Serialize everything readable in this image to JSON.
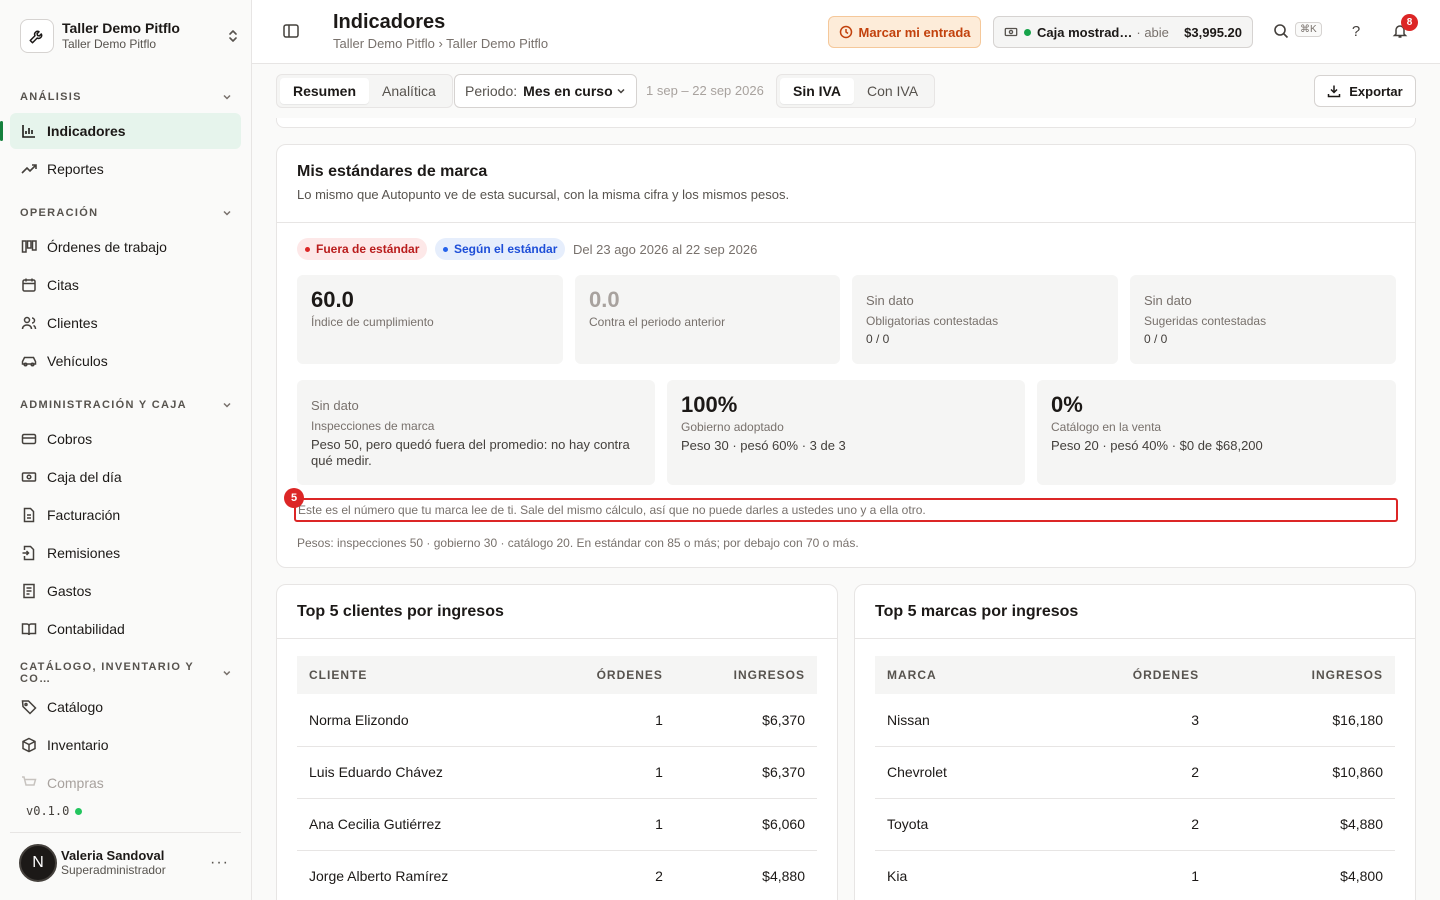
{
  "workspace": {
    "name": "Taller Demo Pitflo",
    "sub": "Taller Demo Pitflo"
  },
  "sidebar": {
    "sections": [
      {
        "label": "ANÁLISIS"
      },
      {
        "label": "OPERACIÓN"
      },
      {
        "label": "ADMINISTRACIÓN Y CAJA"
      },
      {
        "label": "CATÁLOGO, INVENTARIO Y CO…"
      }
    ],
    "items": [
      {
        "label": "Indicadores",
        "icon": "bar-chart-icon"
      },
      {
        "label": "Reportes",
        "icon": "trend-up-icon"
      },
      {
        "label": "Órdenes de trabajo",
        "icon": "kanban-icon"
      },
      {
        "label": "Citas",
        "icon": "calendar-icon"
      },
      {
        "label": "Clientes",
        "icon": "users-icon"
      },
      {
        "label": "Vehículos",
        "icon": "car-icon"
      },
      {
        "label": "Cobros",
        "icon": "card-icon"
      },
      {
        "label": "Caja del día",
        "icon": "cash-icon"
      },
      {
        "label": "Facturación",
        "icon": "file-icon"
      },
      {
        "label": "Remisiones",
        "icon": "file-arrow-icon"
      },
      {
        "label": "Gastos",
        "icon": "receipt-icon"
      },
      {
        "label": "Contabilidad",
        "icon": "book-icon"
      },
      {
        "label": "Catálogo",
        "icon": "tag-icon"
      },
      {
        "label": "Inventario",
        "icon": "box-icon"
      },
      {
        "label": "Compras",
        "icon": "cart-icon"
      }
    ],
    "version": "v0.1.0"
  },
  "user": {
    "initial": "N",
    "name": "Valeria Sandoval",
    "role": "Superadministrador"
  },
  "header": {
    "title": "Indicadores",
    "breadcrumb": "Taller Demo Pitflo › Taller Demo Pitflo",
    "mark_entry": "Marcar mi entrada",
    "register_name": "Caja mostrad…",
    "register_status": "abie",
    "register_amount": "$3,995.20",
    "shortcut": "⌘K",
    "notifications": "8"
  },
  "toolbar": {
    "tabs": [
      "Resumen",
      "Analítica"
    ],
    "period_label": "Periodo:",
    "period_value": "Mes en curso",
    "range": "1 sep – 22 sep 2026",
    "tax": [
      "Sin IVA",
      "Con IVA"
    ],
    "export": "Exportar"
  },
  "standards": {
    "title": "Mis estándares de marca",
    "subtitle": "Lo mismo que Autopunto ve de esta sucursal, con la misma cifra y los mismos pesos.",
    "pill_out": "Fuera de estándar",
    "pill_in": "Según el estándar",
    "range": "Del 23 ago 2026 al 22 sep 2026",
    "kpis": [
      {
        "value": "60.0",
        "label": "Índice de cumplimiento"
      },
      {
        "value": "0.0",
        "label": "Contra el periodo anterior"
      },
      {
        "value": "Sin dato",
        "label": "Obligatorias contestadas",
        "extra": "0 / 0"
      },
      {
        "value": "Sin dato",
        "label": "Sugeridas contestadas",
        "extra": "0 / 0"
      }
    ],
    "kpis2": [
      {
        "value": "Sin dato",
        "label": "Inspecciones de marca",
        "extra": "Peso 50, pero quedó fuera del promedio: no hay contra qué medir."
      },
      {
        "value": "100%",
        "label": "Gobierno adoptado",
        "extra": "Peso 30 · pesó 60% · 3 de 3"
      },
      {
        "value": "0%",
        "label": "Catálogo en la venta",
        "extra": "Peso 20 · pesó 40% · $0 de $68,200"
      }
    ],
    "marker": "5",
    "note": "Este es el número que tu marca lee de ti. Sale del mismo cálculo, así que no puede darles a ustedes uno y a ella otro.",
    "weights": "Pesos: inspecciones 50 · gobierno 30 · catálogo 20. En estándar con 85 o más; por debajo con 70 o más."
  },
  "top_clients": {
    "title": "Top 5 clientes por ingresos",
    "headers": [
      "CLIENTE",
      "ÓRDENES",
      "INGRESOS"
    ],
    "rows": [
      [
        "Norma Elizondo",
        "1",
        "$6,370"
      ],
      [
        "Luis Eduardo Chávez",
        "1",
        "$6,370"
      ],
      [
        "Ana Cecilia Gutiérrez",
        "1",
        "$6,060"
      ],
      [
        "Jorge Alberto Ramírez",
        "2",
        "$4,880"
      ]
    ]
  },
  "top_brands": {
    "title": "Top 5 marcas por ingresos",
    "headers": [
      "MARCA",
      "ÓRDENES",
      "INGRESOS"
    ],
    "rows": [
      [
        "Nissan",
        "3",
        "$16,180"
      ],
      [
        "Chevrolet",
        "2",
        "$10,860"
      ],
      [
        "Toyota",
        "2",
        "$4,880"
      ],
      [
        "Kia",
        "1",
        "$4,800"
      ]
    ]
  }
}
